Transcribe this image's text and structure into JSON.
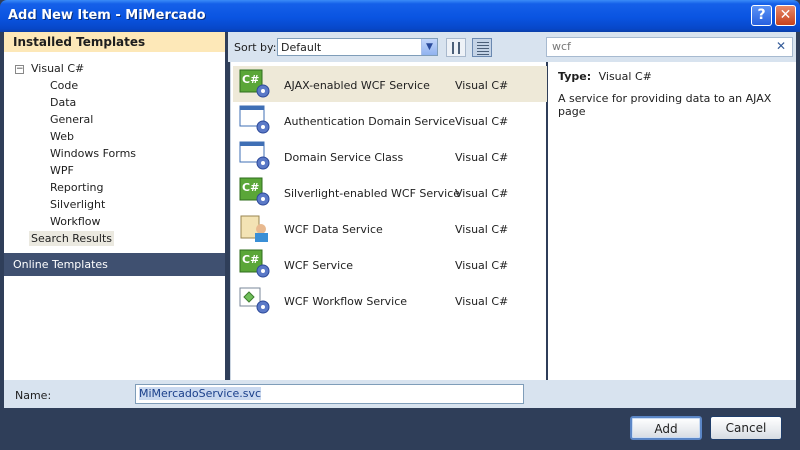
{
  "window": {
    "title": "Add New Item - MiMercado",
    "help_glyph": "?",
    "close_glyph": "✕"
  },
  "left": {
    "installed_header": "Installed Templates",
    "toggle_glyph": "−",
    "tree": {
      "root": "Visual C#",
      "children": [
        "Code",
        "Data",
        "General",
        "Web",
        "Windows Forms",
        "WPF",
        "Reporting",
        "Silverlight",
        "Workflow"
      ],
      "selected": "Search Results"
    },
    "online": "Online Templates"
  },
  "toolbar": {
    "sort_label": "Sort by:",
    "sort_value": "Default",
    "dropdown_glyph": "▼"
  },
  "search": {
    "value": "wcf",
    "clear_glyph": "✕"
  },
  "items": [
    {
      "name": "AJAX-enabled WCF Service",
      "lang": "Visual C#",
      "icon": "wcf-csharp-icon"
    },
    {
      "name": "Authentication Domain Service",
      "lang": "Visual C#",
      "icon": "domain-service-icon"
    },
    {
      "name": "Domain Service Class",
      "lang": "Visual C#",
      "icon": "domain-service-icon"
    },
    {
      "name": "Silverlight-enabled WCF Service",
      "lang": "Visual C#",
      "icon": "wcf-csharp-icon"
    },
    {
      "name": "WCF Data Service",
      "lang": "Visual C#",
      "icon": "data-service-icon"
    },
    {
      "name": "WCF Service",
      "lang": "Visual C#",
      "icon": "wcf-csharp-icon"
    },
    {
      "name": "WCF Workflow Service",
      "lang": "Visual C#",
      "icon": "workflow-service-icon"
    }
  ],
  "details": {
    "type_label": "Type:",
    "type_value": "Visual C#",
    "description": "A service for providing data to an AJAX page"
  },
  "name_field": {
    "label": "Name:",
    "value": "MiMercadoService.svc"
  },
  "buttons": {
    "add": "Add",
    "cancel": "Cancel"
  },
  "colors": {
    "title_bar": "#0a54e1",
    "panel_bg": "#2f3e59",
    "selection": "#eee9d8",
    "installed_header": "#fde8b8"
  }
}
